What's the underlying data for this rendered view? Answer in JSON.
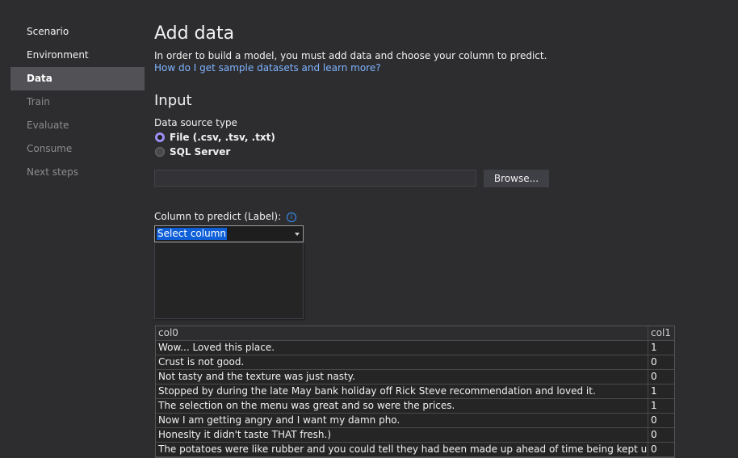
{
  "sidebar": {
    "items": [
      {
        "label": "Scenario",
        "state": "enabled"
      },
      {
        "label": "Environment",
        "state": "enabled"
      },
      {
        "label": "Data",
        "state": "active"
      },
      {
        "label": "Train",
        "state": "disabled"
      },
      {
        "label": "Evaluate",
        "state": "disabled"
      },
      {
        "label": "Consume",
        "state": "disabled"
      },
      {
        "label": "Next steps",
        "state": "disabled"
      }
    ]
  },
  "header": {
    "title": "Add data",
    "description": "In order to build a model, you must add data and choose your column to predict.",
    "help_link": "How do I get sample datasets and learn more?"
  },
  "input": {
    "section_title": "Input",
    "data_source_label": "Data source type",
    "options": [
      {
        "label": "File (.csv, .tsv, .txt)",
        "selected": true
      },
      {
        "label": "SQL Server",
        "selected": false
      }
    ],
    "file_path_value": "",
    "browse_label": "Browse..."
  },
  "label_column": {
    "label": "Column to predict (Label):",
    "selected": "Select column",
    "info_icon": "info-icon"
  },
  "preview": {
    "columns": [
      "col0",
      "col1"
    ],
    "rows": [
      [
        "Wow... Loved this place.",
        "1"
      ],
      [
        "Crust is not good.",
        "0"
      ],
      [
        "Not tasty and the texture was just nasty.",
        "0"
      ],
      [
        "Stopped by during the late May bank holiday off Rick Steve recommendation and loved it.",
        "1"
      ],
      [
        "The selection on the menu was great and so were the prices.",
        "1"
      ],
      [
        "Now I am getting angry and I want my damn pho.",
        "0"
      ],
      [
        "Honeslty it didn't taste THAT fresh.)",
        "0"
      ],
      [
        "The potatoes were like rubber and you could tell they had been made up ahead of time being kept under a warmer.",
        "0"
      ]
    ]
  },
  "colors": {
    "background": "#2d2d30",
    "active_nav": "#525256",
    "link": "#7fb4ff",
    "radio_selected": "#9b8ef2",
    "selection_highlight": "#0e5fd8"
  }
}
